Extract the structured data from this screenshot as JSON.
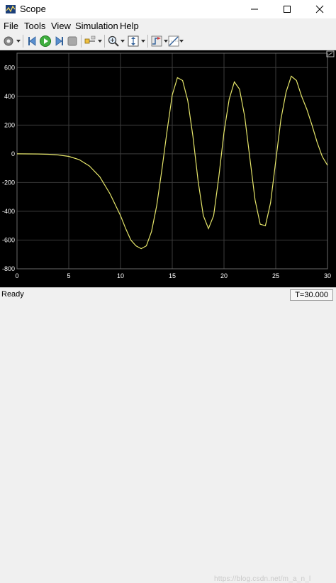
{
  "window": {
    "title": "Scope"
  },
  "menu": [
    {
      "label": "File"
    },
    {
      "label": "Tools"
    },
    {
      "label": "View"
    },
    {
      "label": "Simulation"
    },
    {
      "label": "Help"
    }
  ],
  "toolbar": {
    "icons": [
      "settings-icon",
      "step-back-icon",
      "run-icon",
      "step-forward-icon",
      "stop-icon",
      "highlight-block-icon",
      "zoom-icon",
      "autoscale-icon",
      "triggers-icon",
      "cursor-measurements-icon"
    ]
  },
  "status": {
    "left": "Ready",
    "right": "T=30.000",
    "watermark": "https://blog.csdn.net/m_a_n_l"
  },
  "colors": {
    "plot_background": "#000000",
    "grid": "#3c3c3c",
    "line": "#e6e66a",
    "tick_text": "#ffffff"
  },
  "chart_data": {
    "type": "line",
    "title": "",
    "xlabel": "",
    "ylabel": "",
    "xlim": [
      0,
      30
    ],
    "ylim": [
      -800,
      700
    ],
    "xticks": [
      0,
      5,
      10,
      15,
      20,
      25,
      30
    ],
    "yticks": [
      600,
      400,
      200,
      0,
      -200,
      -400,
      -600,
      -800
    ],
    "grid": true,
    "series": [
      {
        "x": [
          0,
          2,
          3,
          4,
          5,
          6,
          7,
          8,
          9,
          10,
          10.5,
          11,
          11.5,
          12,
          12.5,
          13,
          13.5,
          14,
          14.5,
          15,
          15.5,
          16,
          16.5,
          17,
          17.5,
          18,
          18.5,
          19,
          19.5,
          20,
          20.5,
          21,
          21.5,
          22,
          22.5,
          23,
          23.5,
          24,
          24.5,
          25,
          25.5,
          26,
          26.5,
          27,
          27.5,
          28,
          28.5,
          29,
          29.5,
          30
        ],
        "y": [
          0,
          -1,
          -3,
          -8,
          -18,
          -40,
          -85,
          -160,
          -280,
          -430,
          -520,
          -600,
          -640,
          -660,
          -640,
          -540,
          -360,
          -110,
          160,
          410,
          530,
          510,
          370,
          120,
          -190,
          -430,
          -520,
          -430,
          -160,
          150,
          380,
          500,
          450,
          260,
          -30,
          -320,
          -490,
          -500,
          -340,
          -50,
          240,
          430,
          540,
          510,
          400,
          310,
          200,
          80,
          -20,
          -80
        ]
      }
    ]
  }
}
